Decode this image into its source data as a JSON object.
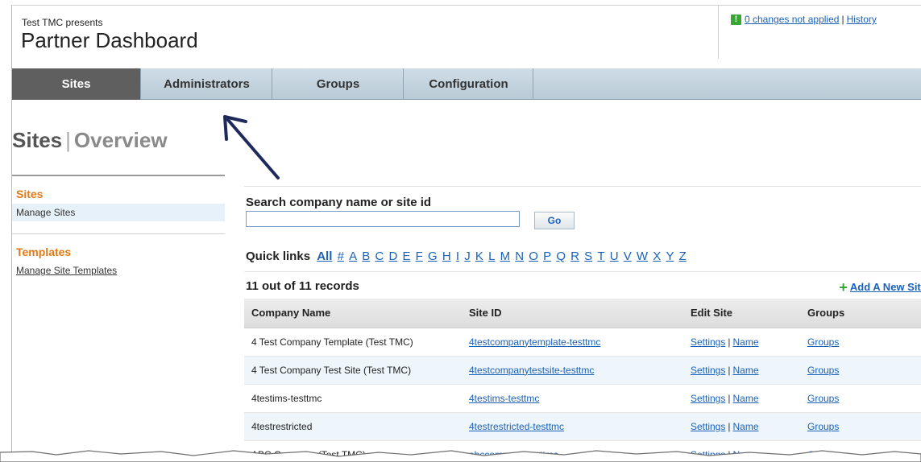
{
  "header": {
    "presents": "Test TMC presents",
    "title": "Partner Dashboard",
    "changes_link": "0 changes not applied",
    "history_link": "History",
    "separator": "|",
    "warn_symbol": "!"
  },
  "tabs": [
    {
      "label": "Sites",
      "active": true
    },
    {
      "label": "Administrators",
      "active": false
    },
    {
      "label": "Groups",
      "active": false
    },
    {
      "label": "Configuration",
      "active": false
    }
  ],
  "page": {
    "section": "Sites",
    "separator": "|",
    "subsection": "Overview"
  },
  "sidebar": {
    "sites_heading": "Sites",
    "manage_sites": "Manage Sites",
    "templates_heading": "Templates",
    "manage_templates": "Manage Site Templates"
  },
  "search": {
    "label": "Search company name or site id",
    "value": "",
    "go_label": "Go"
  },
  "quick_links": {
    "label": "Quick links",
    "all": "All",
    "items": [
      "#",
      "A",
      "B",
      "C",
      "D",
      "E",
      "F",
      "G",
      "H",
      "I",
      "J",
      "K",
      "L",
      "M",
      "N",
      "O",
      "P",
      "Q",
      "R",
      "S",
      "T",
      "U",
      "V",
      "W",
      "X",
      "Y",
      "Z"
    ]
  },
  "records": {
    "count_text": "11 out of 11 records",
    "add_label": "Add A New Site"
  },
  "table": {
    "columns": [
      "Company Name",
      "Site ID",
      "Edit Site",
      "Groups"
    ],
    "rows": [
      {
        "company": "4 Test Company Template (Test TMC)",
        "site_id": "4testcompanytemplate-testtmc",
        "settings": "Settings",
        "name": "Name",
        "groups": "Groups"
      },
      {
        "company": "4 Test Company Test Site (Test TMC)",
        "site_id": "4testcompanytestsite-testtmc",
        "settings": "Settings",
        "name": "Name",
        "groups": "Groups"
      },
      {
        "company": "4testims-testtmc",
        "site_id": "4testims-testtmc",
        "settings": "Settings",
        "name": "Name",
        "groups": "Groups"
      },
      {
        "company": "4testrestricted",
        "site_id": "4testrestricted-testtmc",
        "settings": "Settings",
        "name": "Name",
        "groups": "Groups"
      },
      {
        "company": "ABC Company (Test TMC)",
        "site_id": "abccompany-testtmc",
        "settings": "Settings",
        "name": "Name",
        "groups": "Groups"
      }
    ]
  },
  "colors": {
    "accent_orange": "#e07a14",
    "link_blue": "#1a62b8",
    "active_tab": "#5f5f5f",
    "tab_bar": "#c4d3de",
    "arrow": "#1f2a5c"
  }
}
